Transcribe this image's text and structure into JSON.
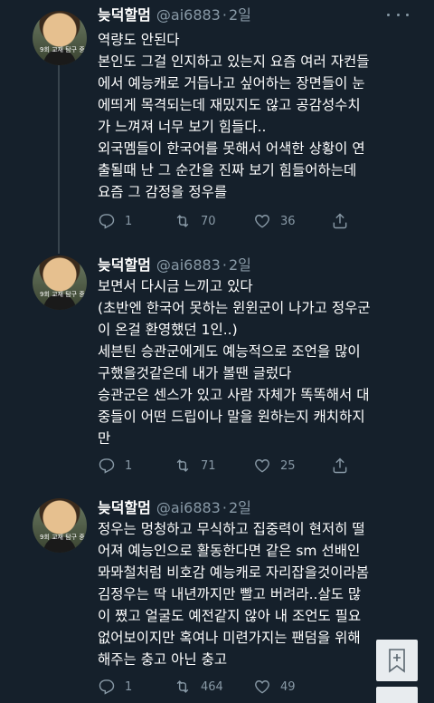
{
  "tweets": [
    {
      "author": "늦덕할멈",
      "handle": "@ai6883",
      "separator": "·",
      "time": "2일",
      "avatar_tag": "9회 교재 탐구 중",
      "text": "역량도 안된다\n본인도 그걸 인지하고 있는지 요즘 여러 자컨들\n에서 예능캐로 거듭나고 싶어하는 장면들이 눈\n에띄게 목격되는데 재밌지도 않고 공감성수치\n가 느껴져 너무 보기 힘들다..\n외국멤들이 한국어를 못해서 어색한 상황이 연\n출될때 난 그 순간을 진짜 보기 힘들어하는데\n요즘 그 감정을 정우를",
      "replies": "1",
      "retweets": "70",
      "likes": "36"
    },
    {
      "author": "늦덕할멈",
      "handle": "@ai6883",
      "separator": "·",
      "time": "2일",
      "avatar_tag": "9회 교재 탐구 중",
      "text": "보면서 다시금 느끼고 있다\n(초반엔 한국어 못하는 윈윈군이 나가고 정우군\n이 온걸 환영했던 1인..)\n세븐틴 승관군에게도 예능적으로 조언을 많이\n구했을것같은데 내가 볼땐 글렀다\n승관군은 센스가 있고 사람 자체가 똑똑해서 대\n중들이 어떤 드립이나 말을 원하는지 캐치하지\n만",
      "replies": "1",
      "retweets": "71",
      "likes": "25"
    },
    {
      "author": "늦덕할멈",
      "handle": "@ai6883",
      "separator": "·",
      "time": "2일",
      "avatar_tag": "9회 교재 탐구 중",
      "text": "정우는 멍청하고 무식하고 집중력이 현저히 떨\n어져 예능인으로 활동한다면 같은 sm 선배인\n뫄뫄철처럼 비호감 예능캐로 자리잡을것이라봄\n김정우는 딱 내년까지만 빨고 버려라..살도 많\n이 쪘고 얼굴도 예전같지 않아 내 조언도 필요\n없어보이지만 혹여나 미련가지는 팬덤을 위해\n해주는 충고 아닌 충고",
      "replies": "1",
      "retweets": "464",
      "likes": "49"
    }
  ],
  "icons": {
    "reply": "reply-icon",
    "retweet": "retweet-icon",
    "like": "heart-icon",
    "share": "share-icon",
    "more": "more-icon",
    "bookmark": "bookmark-add-icon"
  },
  "colors": {
    "background": "#15202b",
    "secondary_text": "#8899a6",
    "divider": "#38444d"
  }
}
